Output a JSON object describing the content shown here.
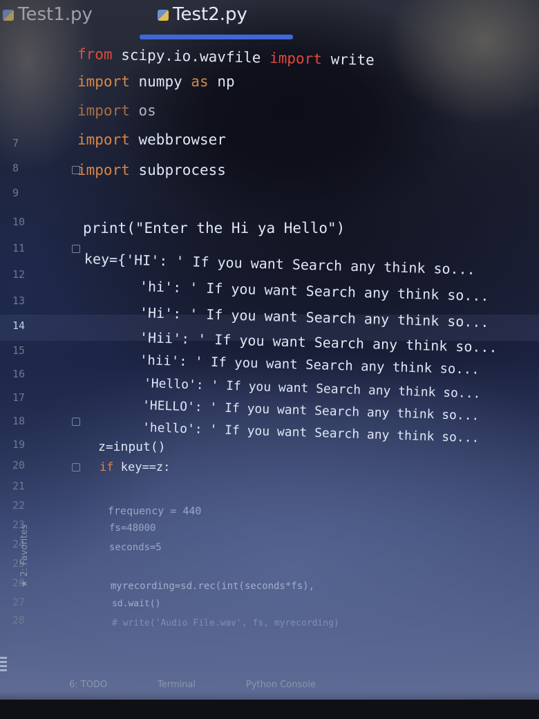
{
  "tabs": [
    {
      "label": "Test1.py"
    },
    {
      "label": "Test2.py"
    }
  ],
  "gutter": {
    "line_numbers": [
      "7",
      "8",
      "9",
      "10",
      "11",
      "12",
      "13",
      "14",
      "15",
      "16",
      "17",
      "18",
      "19",
      "20",
      "21",
      "22",
      "23",
      "24",
      "25",
      "26",
      "27",
      "28"
    ],
    "current_line": "14",
    "favorites_label": "★ 2: Favorites"
  },
  "code": {
    "l1": {
      "kw1": "from",
      "mod": "scipy.io.wavfile",
      "kw2": "import",
      "name": "write"
    },
    "l2": {
      "kw": "import",
      "mod": "numpy",
      "as": "as",
      "alias": "np"
    },
    "l3": {
      "kw": "import",
      "mod": "os"
    },
    "l4": {
      "kw": "import",
      "mod": "webbrowser"
    },
    "l5": {
      "kw": "import",
      "mod": "subprocess"
    },
    "l6": "print(\"Enter the Hi ya Hello\")",
    "l7": "key={'HI': ' If you want Search any think so...",
    "l8": "'hi': ' If you want Search any think so...",
    "l9": "'Hi': ' If you want Search any think so...",
    "l10": "'Hii': ' If you want Search any think so...",
    "l11": "'hii': ' If you want Search any think so...",
    "l12": "'Hello': ' If you want Search any think so...",
    "l13": "'HELLO': ' If you want Search any think so...",
    "l14": "'hello': ' If you want Search any think so...",
    "l15": "z=input()",
    "l16": {
      "kw": "if",
      "rest": "key==z:"
    },
    "l17": "frequency = 440",
    "l18": "fs=48000",
    "l19": "seconds=5",
    "l20": "myrecording=sd.rec(int(seconds*fs),",
    "l21": "sd.wait()",
    "l22": "# write('Audio File.wav', fs, myrecording)"
  },
  "bottom": {
    "todo": "6: TODO",
    "terminal": "Terminal",
    "python_console": "Python Console"
  }
}
